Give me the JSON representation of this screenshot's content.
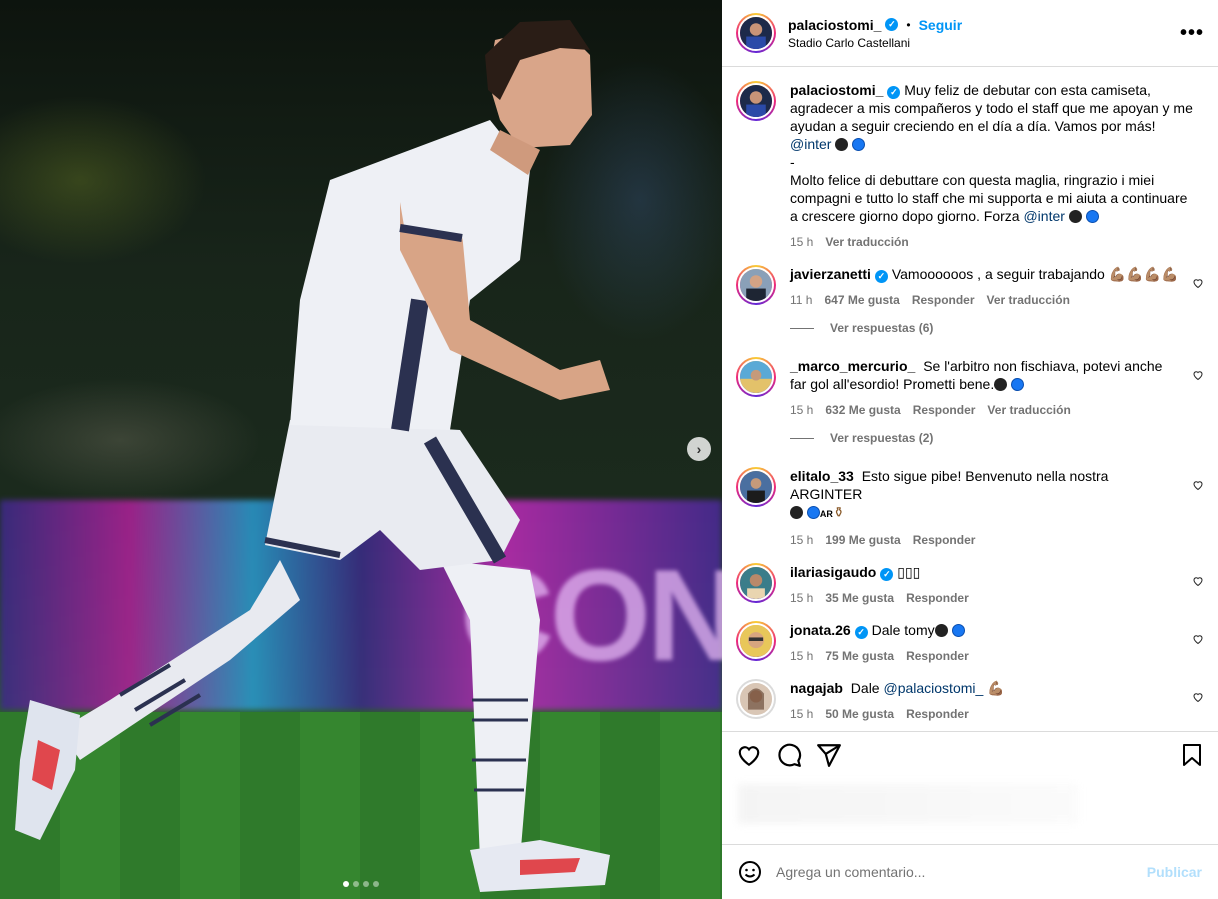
{
  "post": {
    "author": "palaciostomi_",
    "follow_label": "Seguir",
    "separator": "•",
    "location": "Stadio Carlo Castellani",
    "more_label": "•••",
    "verified_mark": "✓"
  },
  "caption": {
    "username": "palaciostomi_",
    "text_es": "Muy feliz de debutar con esta camiseta, agradecer a mis compañeros y todo el staff que me apoyan y me ayudan a seguir creciendo en el día a día. Vamos por más!",
    "mention_1": "@inter",
    "dash": "-",
    "text_it": "Molto felice di debuttare con questa maglia, ringrazio i miei compagni e tutto lo staff che mi supporta e mi aiuta a continuare a crescere giorno dopo giorno. Forza",
    "mention_2": "@inter",
    "time": "15 h",
    "translate": "Ver traducción"
  },
  "comments": [
    {
      "username": "javierzanetti",
      "verified": true,
      "text": "Vamoooooos , a seguir trabajando",
      "emoji": "💪🏽💪🏽💪🏽💪🏽",
      "time": "11 h",
      "likes": "647 Me gusta",
      "reply": "Responder",
      "translate": "Ver traducción",
      "replies_label": "Ver respuestas (6)"
    },
    {
      "username": "_marco_mercurio_",
      "verified": false,
      "text": "Se l'arbitro non fischiava, potevi anche far gol all'esordio! Prometti bene.",
      "time": "15 h",
      "likes": "632 Me gusta",
      "reply": "Responder",
      "translate": "Ver traducción",
      "replies_label": "Ver respuestas (2)"
    },
    {
      "username": "elitalo_33",
      "verified": false,
      "text": "Esto sigue pibe! Benvenuto nella nostra ARGINTER",
      "emoji_tail": "AR",
      "time": "15 h",
      "likes": "199 Me gusta",
      "reply": "Responder"
    },
    {
      "username": "ilariasigaudo",
      "verified": true,
      "text": "▯▯▯",
      "time": "15 h",
      "likes": "35 Me gusta",
      "reply": "Responder"
    },
    {
      "username": "jonata.26",
      "verified": true,
      "text": "Dale tomy",
      "time": "15 h",
      "likes": "75 Me gusta",
      "reply": "Responder"
    },
    {
      "username": "nagajab",
      "verified": false,
      "text": "Dale",
      "mention": "@palaciostomi_",
      "emoji": "💪🏽",
      "time": "15 h",
      "likes": "50 Me gusta",
      "reply": "Responder"
    }
  ],
  "carousel": {
    "count": 4,
    "active": 1
  },
  "composer": {
    "placeholder": "Agrega un comentario...",
    "post_label": "Publicar"
  },
  "colors": {
    "accent": "#0095f6",
    "text_muted": "#737373",
    "border": "#dbdbdb",
    "link": "#00376b"
  }
}
